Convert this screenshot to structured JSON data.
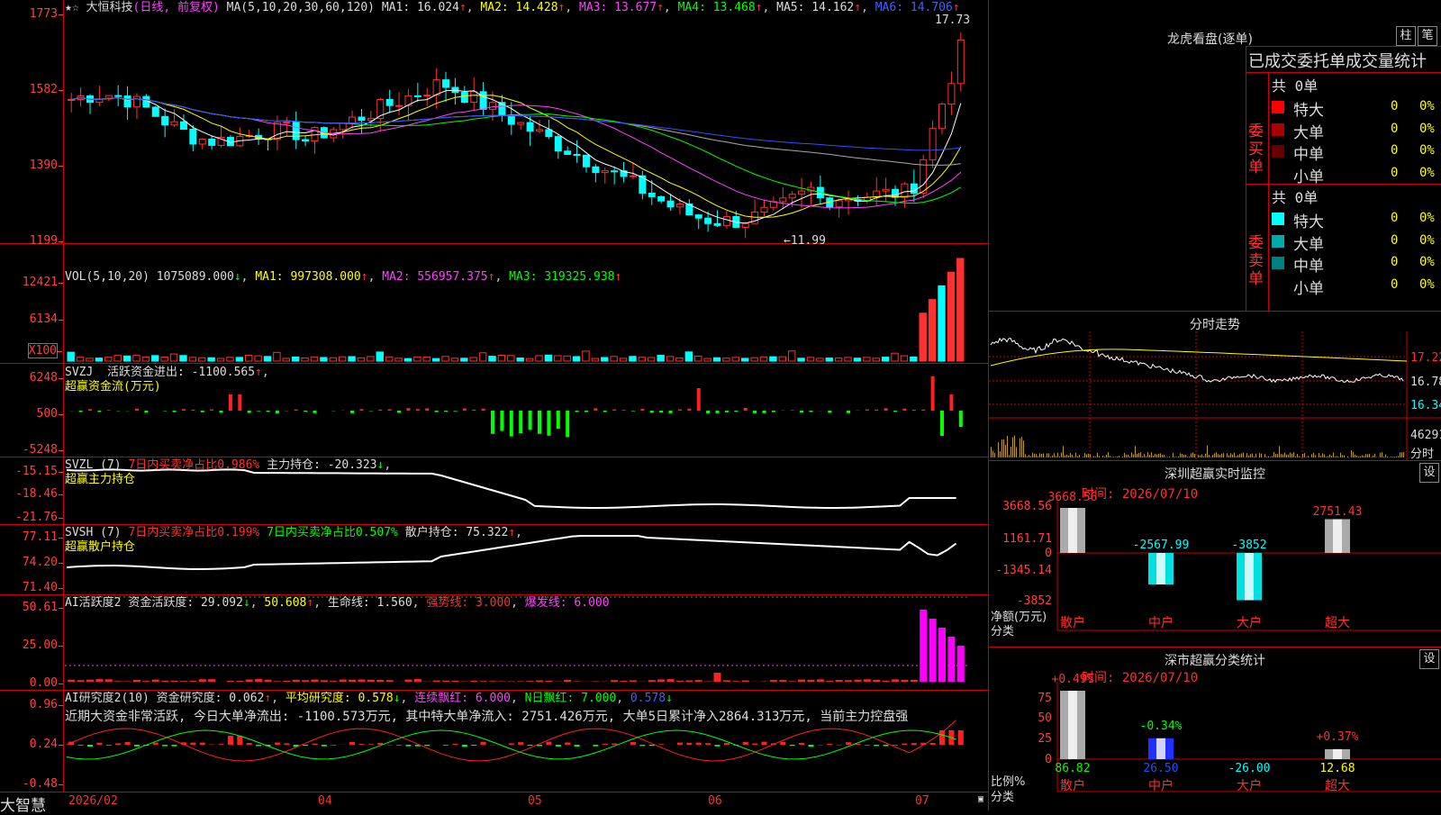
{
  "app": {
    "name": "大智慧"
  },
  "stock": {
    "name": "大恒科技",
    "mode": "(日线, 前复权)",
    "ma_params": "MA(5,10,20,30,60,120)",
    "ma1": "MA1: 16.024",
    "ma2": "MA2: 14.428",
    "ma3": "MA3: 13.677",
    "ma4": "MA4: 13.468",
    "ma5": "MA5: 14.162",
    "ma6": "MA6: 14.706",
    "high_mark": "17.73",
    "low_mark": "←11.99"
  },
  "price_axis": [
    "1773",
    "1582",
    "1390",
    "1199"
  ],
  "vol": {
    "label": "VOL(5,10,20)",
    "value": "1075089.000",
    "ma1": "MA1: 997308.000",
    "ma2": "MA2: 556957.375",
    "ma3": "MA3: 319325.938",
    "axis": [
      "12421",
      "6134",
      "X100"
    ]
  },
  "svzj": {
    "label": "SVZJ",
    "text": "活跃资金进出: -1100.565",
    "sub": "超赢资金流(万元)",
    "axis": [
      "6248",
      "500",
      "-5248"
    ]
  },
  "svzl": {
    "label": "SVZL (7)",
    "t1": "7日内买卖净占比0.986%",
    "t2": "主力持仓: -20.323",
    "sub": "超赢主力持仓",
    "axis": [
      "-15.15",
      "-18.46",
      "-21.76"
    ]
  },
  "svsh": {
    "label": "SVSH (7)",
    "t1": "7日内买卖净占比0.199%",
    "t2": "7日内买卖净占比0.507%",
    "t3": "散户持仓: 75.322",
    "sub": "超赢散户持仓",
    "axis": [
      "77.11",
      "74.20",
      "71.40"
    ]
  },
  "ai1": {
    "label": "AI活跃度2",
    "t1": "资金活跃度: 29.092",
    "t2": "50.608",
    "t3": "生命线: 1.560",
    "t4": "强势线: 3.000",
    "t5": "爆发线: 6.000",
    "axis": [
      "50.61",
      "25.00",
      "0.00"
    ]
  },
  "ai2": {
    "label": "AI研究度2(10)",
    "t1": "资金研究度: 0.062",
    "t2": "平均研究度: 0.578",
    "t3": "连续飘红: 6.000",
    "t4": "N日飘红: 7.000",
    "t5": "0.578",
    "note": "近期大资金非常活跃, 今日大单净流出: -1100.573万元, 其中特大单净流入: 2751.426万元, 大单5日累计净入2864.313万元, 当前主力控盘强",
    "axis": [
      "0.96",
      "0.24",
      "-0.48"
    ]
  },
  "date_axis": [
    "2026/02",
    "04",
    "05",
    "06",
    "07"
  ],
  "longhu": {
    "title": "龙虎看盘(逐单)",
    "btn1": "柱",
    "btn2": "笔",
    "subtitle": "已成交委托单成交量统计",
    "buy_label": "委买单",
    "sell_label": "委卖单",
    "buy_total": "共 0单",
    "sell_total": "共 0单",
    "buy_rows": [
      {
        "name": "特大",
        "v": "0",
        "p": "0%"
      },
      {
        "name": "大单",
        "v": "0",
        "p": "0%"
      },
      {
        "name": "中单",
        "v": "0",
        "p": "0%"
      },
      {
        "name": "小单",
        "v": "0",
        "p": "0%"
      }
    ],
    "sell_rows": [
      {
        "name": "特大",
        "v": "0",
        "p": "0%"
      },
      {
        "name": "大单",
        "v": "0",
        "p": "0%"
      },
      {
        "name": "中单",
        "v": "0",
        "p": "0%"
      },
      {
        "name": "小单",
        "v": "0",
        "p": "0%"
      }
    ]
  },
  "fenshi": {
    "title": "分时走势",
    "axis": [
      "17.22",
      "16.78",
      "16.34"
    ],
    "vol": "46291",
    "vol_unit": "分时"
  },
  "sz_monitor": {
    "title": "深圳超赢实时监控",
    "btn": "设",
    "time": "时间: 2026/07/10",
    "axis": [
      "3668.56",
      "1161.71",
      "0",
      "-1345.14",
      "-3852"
    ],
    "unit": "净额(万元)",
    "unit2": "分类",
    "cats": [
      "散户",
      "中户",
      "大户",
      "超大"
    ],
    "values": [
      3668.56,
      -2567.99,
      -3852,
      2751.43
    ],
    "labels": [
      "3668.56",
      "-2567.99",
      "-3852",
      "2751.43"
    ]
  },
  "sz_class": {
    "title": "深市超赢分类统计",
    "btn": "设",
    "time": "时间: 2026/07/10",
    "axis": [
      "75",
      "50",
      "25",
      "0"
    ],
    "unit": "比例%",
    "unit2": "分类",
    "cats": [
      "散户",
      "中户",
      "大户",
      "超大"
    ],
    "pct": [
      "+0.49%",
      "-0.34%",
      "",
      "+0.37%"
    ],
    "bottom": [
      "86.82",
      "26.50",
      "-26.00",
      "12.68"
    ],
    "values": [
      86.82,
      26.5,
      -26.0,
      12.68
    ]
  }
}
